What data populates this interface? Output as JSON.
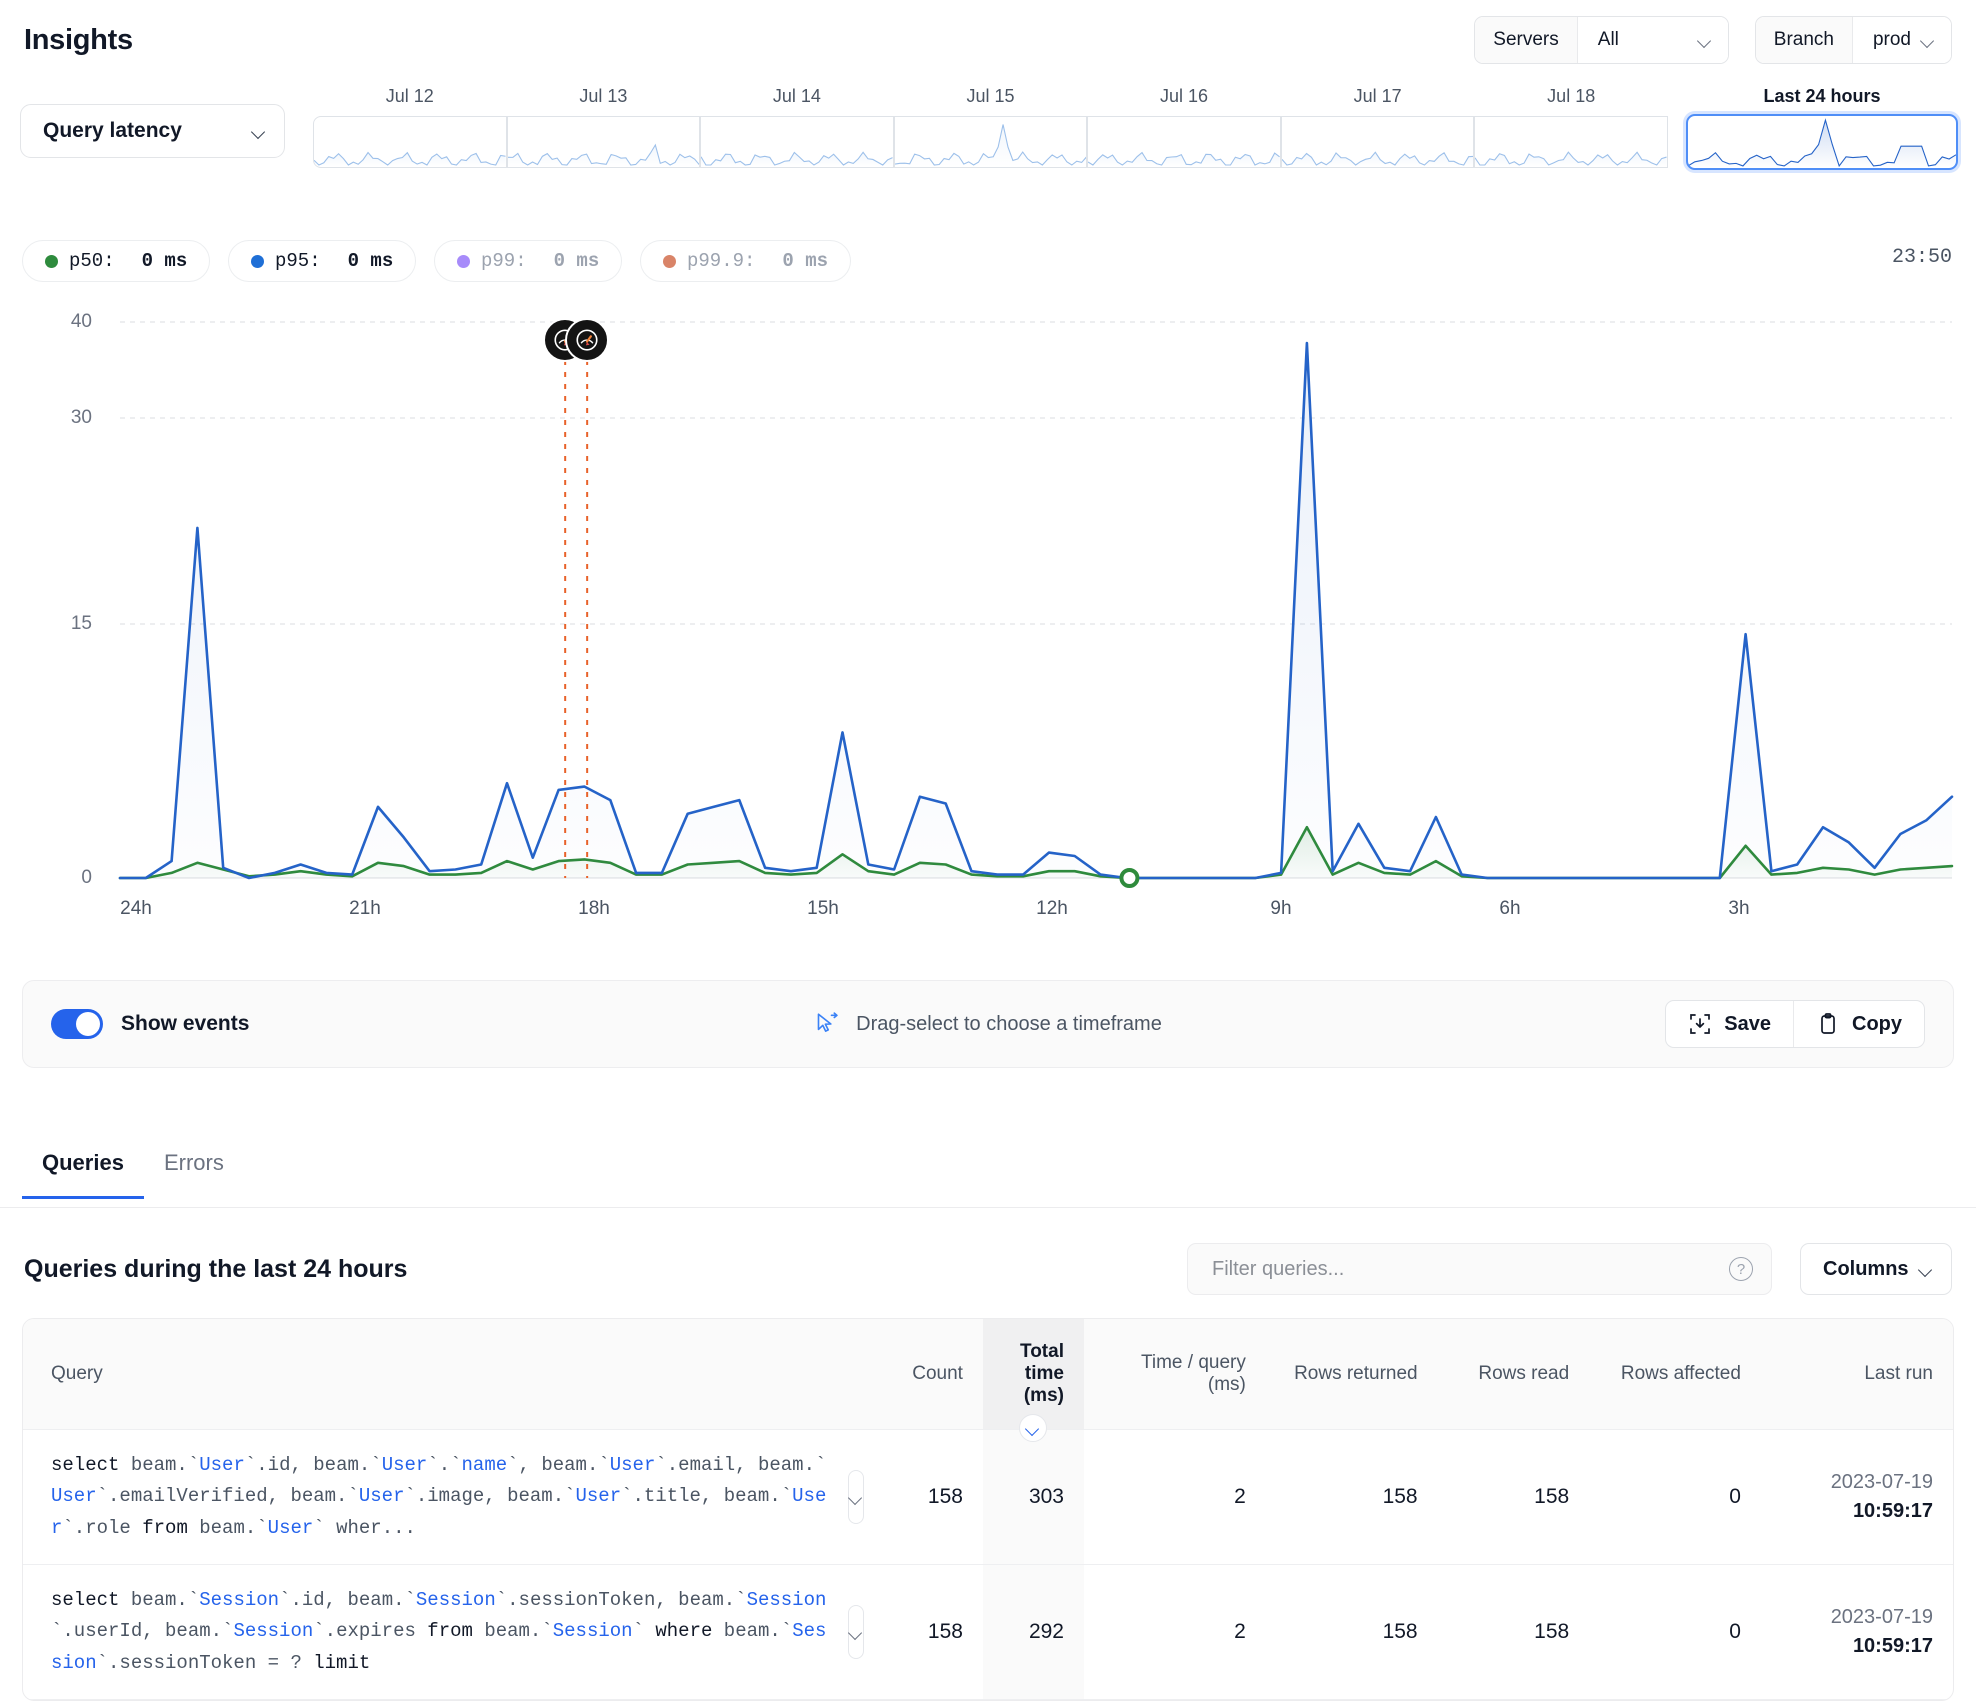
{
  "header": {
    "title": "Insights",
    "servers": {
      "label": "Servers",
      "value": "All"
    },
    "branch": {
      "label": "Branch",
      "value": "prod"
    }
  },
  "range": {
    "metric": "Query latency",
    "buckets": [
      {
        "label": "Jul 12",
        "selected": false
      },
      {
        "label": "Jul 13",
        "selected": false
      },
      {
        "label": "Jul 14",
        "selected": false
      },
      {
        "label": "Jul 15",
        "selected": false
      },
      {
        "label": "Jul 16",
        "selected": false
      },
      {
        "label": "Jul 17",
        "selected": false
      },
      {
        "label": "Jul 18",
        "selected": false
      },
      {
        "label": "Last 24 hours",
        "selected": true
      }
    ]
  },
  "legend": {
    "items": [
      {
        "name": "p50",
        "label": "p50:",
        "value": "0 ms",
        "color": "#2e8b3d",
        "active": true
      },
      {
        "name": "p95",
        "label": "p95:",
        "value": "0 ms",
        "color": "#1f6fd6",
        "active": true
      },
      {
        "name": "p99",
        "label": "p99:",
        "value": "0 ms",
        "color": "#a78bfa",
        "active": false
      },
      {
        "name": "p99.9",
        "label": "p99.9:",
        "value": "0 ms",
        "color": "#d98468",
        "active": false
      }
    ],
    "clock": "23:50"
  },
  "chart_data": {
    "type": "line",
    "title": "Query latency",
    "xlabel": "",
    "ylabel": "ms",
    "grid": true,
    "legend_position": "top-left",
    "ylim": [
      0,
      40
    ],
    "yticks": [
      0,
      15,
      30,
      40
    ],
    "xticks": [
      "24h",
      "21h",
      "18h",
      "15h",
      "12h",
      "9h",
      "6h",
      "3h"
    ],
    "series": [
      {
        "name": "p95",
        "color": "#2563c8",
        "values": [
          0,
          0,
          1,
          22,
          0.6,
          0,
          0.3,
          0.8,
          0.3,
          0.2,
          4.2,
          2.4,
          0.4,
          0.5,
          0.8,
          5.6,
          1.2,
          5.2,
          5.4,
          4.6,
          0.3,
          0.3,
          3.8,
          4.2,
          4.6,
          0.6,
          0.4,
          0.6,
          8.6,
          0.8,
          0.5,
          4.8,
          4.4,
          0.4,
          0.2,
          0.2,
          1.5,
          1.3,
          0.2,
          0,
          0,
          0,
          0,
          0,
          0,
          0.3,
          37.8,
          0.4,
          3.2,
          0.6,
          0.4,
          3.6,
          0.2,
          0,
          0,
          0,
          0,
          0,
          0,
          0,
          0,
          0,
          0,
          14.4,
          0.4,
          0.8,
          3.0,
          2.1,
          0.6,
          2.6,
          3.4,
          4.8
        ]
      },
      {
        "name": "p50",
        "color": "#2f8b3c",
        "values": [
          0,
          0,
          0.3,
          0.9,
          0.5,
          0.1,
          0.2,
          0.4,
          0.2,
          0.1,
          0.9,
          0.7,
          0.2,
          0.2,
          0.3,
          1.0,
          0.5,
          1.0,
          1.1,
          0.9,
          0.2,
          0.2,
          0.8,
          0.9,
          1.0,
          0.3,
          0.2,
          0.3,
          1.4,
          0.4,
          0.2,
          0.9,
          0.8,
          0.2,
          0.1,
          0.1,
          0.4,
          0.4,
          0.1,
          0,
          0,
          0,
          0,
          0,
          0,
          0.2,
          3.0,
          0.2,
          0.9,
          0.3,
          0.2,
          1.0,
          0.1,
          0,
          0,
          0,
          0,
          0,
          0,
          0,
          0,
          0,
          0,
          1.9,
          0.2,
          0.3,
          0.6,
          0.5,
          0.2,
          0.5,
          0.6,
          0.7
        ]
      }
    ],
    "events": [
      {
        "name": "event-marker-1",
        "icon": "gauge-icon",
        "x_fraction": 0.243
      },
      {
        "name": "event-marker-2",
        "icon": "gauge-icon",
        "x_fraction": 0.255
      }
    ],
    "point_marker": {
      "name": "deploy-marker",
      "color": "#2f8b3c",
      "x_fraction": 0.551
    }
  },
  "toolbar": {
    "show_events_label": "Show events",
    "show_events_on": true,
    "hint": "Drag-select to choose a timeframe",
    "save_label": "Save",
    "copy_label": "Copy"
  },
  "tabs": [
    {
      "label": "Queries",
      "active": true
    },
    {
      "label": "Errors",
      "active": false
    }
  ],
  "queries": {
    "title": "Queries during the last 24 hours",
    "filter_placeholder": "Filter queries...",
    "filter_value": "",
    "columns_label": "Columns",
    "headers": {
      "query": "Query",
      "count": "Count",
      "total_time": "Total time (ms)",
      "time_per_query": "Time / query (ms)",
      "rows_returned": "Rows returned",
      "rows_read": "Rows read",
      "rows_affected": "Rows affected",
      "last_run": "Last run"
    },
    "sorted_column": "total_time",
    "rows": [
      {
        "sql_parts": [
          {
            "t": "select ",
            "c": "kw"
          },
          {
            "t": "beam.`",
            "c": ""
          },
          {
            "t": "User",
            "c": "id"
          },
          {
            "t": "`.id, beam.`",
            "c": ""
          },
          {
            "t": "User",
            "c": "id"
          },
          {
            "t": "`.`",
            "c": ""
          },
          {
            "t": "name",
            "c": "id"
          },
          {
            "t": "`, beam.`",
            "c": ""
          },
          {
            "t": "User",
            "c": "id"
          },
          {
            "t": "`.email, beam.`",
            "c": ""
          },
          {
            "t": "User",
            "c": "id"
          },
          {
            "t": "`.emailVerified, beam.`",
            "c": ""
          },
          {
            "t": "User",
            "c": "id"
          },
          {
            "t": "`.image, beam.`",
            "c": ""
          },
          {
            "t": "User",
            "c": "id"
          },
          {
            "t": "`.title, beam.`",
            "c": ""
          },
          {
            "t": "User",
            "c": "id"
          },
          {
            "t": "`.role ",
            "c": ""
          },
          {
            "t": "from ",
            "c": "kw"
          },
          {
            "t": "beam.`",
            "c": ""
          },
          {
            "t": "User",
            "c": "id"
          },
          {
            "t": "` wher...",
            "c": ""
          }
        ],
        "count": "158",
        "total_time": "303",
        "time_per_query": "2",
        "rows_returned": "158",
        "rows_read": "158",
        "rows_affected": "0",
        "last_run_date": "2023-07-19",
        "last_run_time": "10:59:17"
      },
      {
        "sql_parts": [
          {
            "t": "select ",
            "c": "kw"
          },
          {
            "t": "beam.`",
            "c": ""
          },
          {
            "t": "Session",
            "c": "id"
          },
          {
            "t": "`.id, beam.`",
            "c": ""
          },
          {
            "t": "Session",
            "c": "id"
          },
          {
            "t": "`.sessionToken, beam.`",
            "c": ""
          },
          {
            "t": "Session",
            "c": "id"
          },
          {
            "t": "`.userId, beam.`",
            "c": ""
          },
          {
            "t": "Session",
            "c": "id"
          },
          {
            "t": "`.expires ",
            "c": ""
          },
          {
            "t": "from ",
            "c": "kw"
          },
          {
            "t": "beam.`",
            "c": ""
          },
          {
            "t": "Session",
            "c": "id"
          },
          {
            "t": "` ",
            "c": ""
          },
          {
            "t": "where ",
            "c": "kw"
          },
          {
            "t": "beam.`",
            "c": ""
          },
          {
            "t": "Session",
            "c": "id"
          },
          {
            "t": "`.sessionToken = ? ",
            "c": ""
          },
          {
            "t": "limit",
            "c": "kw"
          }
        ],
        "count": "158",
        "total_time": "292",
        "time_per_query": "2",
        "rows_returned": "158",
        "rows_read": "158",
        "rows_affected": "0",
        "last_run_date": "2023-07-19",
        "last_run_time": "10:59:17"
      }
    ]
  }
}
